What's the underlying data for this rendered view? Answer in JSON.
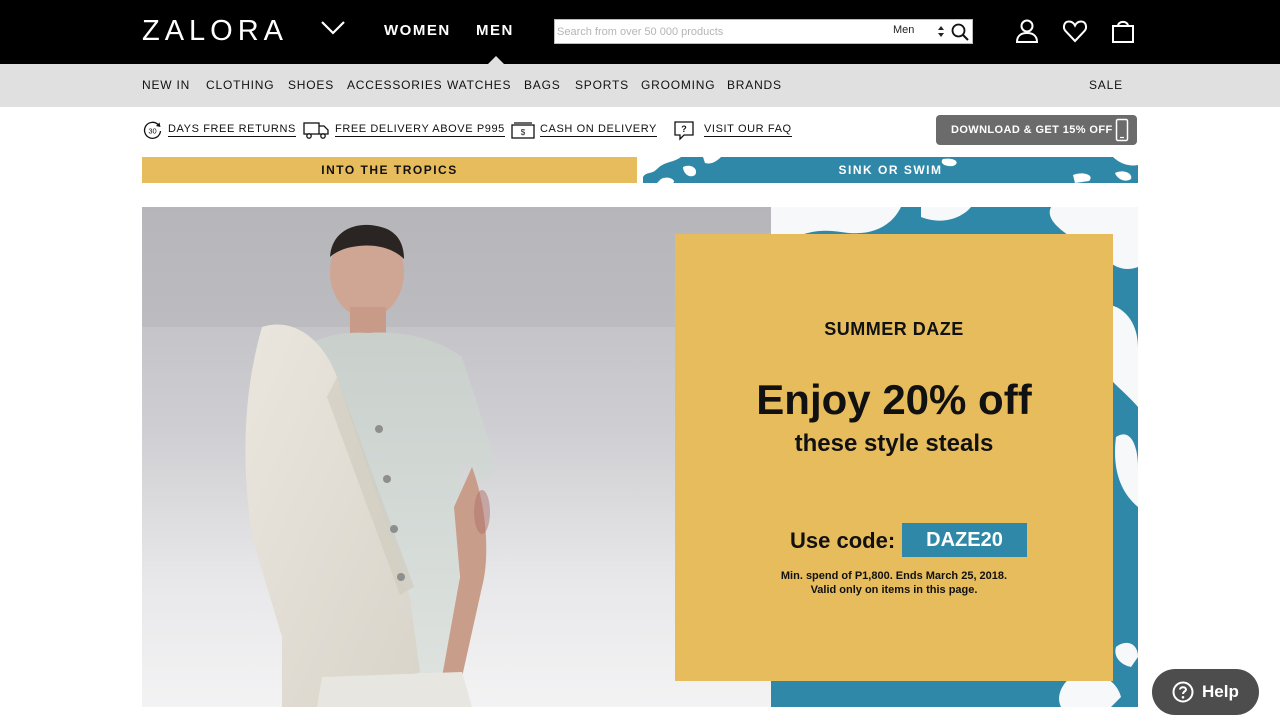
{
  "header": {
    "logo": "ZALORA",
    "genders": [
      "WOMEN",
      "MEN"
    ],
    "active_gender": "MEN",
    "search": {
      "placeholder": "Search from over 50 000 products",
      "scope": "Men"
    },
    "icons": [
      "chevron-down-icon",
      "search-icon",
      "account-icon",
      "heart-icon",
      "shopping-bag-icon"
    ]
  },
  "categories": [
    "NEW IN",
    "CLOTHING",
    "SHOES",
    "ACCESSORIES",
    "WATCHES",
    "BAGS",
    "SPORTS",
    "GROOMING",
    "BRANDS"
  ],
  "sale_label": "SALE",
  "usps": [
    {
      "icon": "returns-30-icon",
      "label": "DAYS FREE RETURNS",
      "badge": "30"
    },
    {
      "icon": "truck-icon",
      "label": "FREE DELIVERY ABOVE P995"
    },
    {
      "icon": "cash-icon",
      "label": "CASH ON DELIVERY"
    },
    {
      "icon": "faq-icon",
      "label": "VISIT OUR FAQ"
    }
  ],
  "download_button": "DOWNLOAD & GET 15% OFF",
  "promo_tabs": [
    "INTO THE TROPICS",
    "SINK OR SWIM"
  ],
  "hero": {
    "eyebrow": "SUMMER DAZE",
    "headline": "Enjoy 20% off",
    "subhead": "these style steals",
    "code_label": "Use code:",
    "code": "DAZE20",
    "fine_print_1": "Min. spend of P1,800. Ends March 25, 2018.",
    "fine_print_2": "Valid only on items in this page."
  },
  "help_label": "Help",
  "colors": {
    "black": "#000000",
    "nav_grey": "#e0e0e0",
    "mustard": "#e6bc5c",
    "teal": "#2f88a8",
    "help_grey": "#4d4d4d"
  }
}
